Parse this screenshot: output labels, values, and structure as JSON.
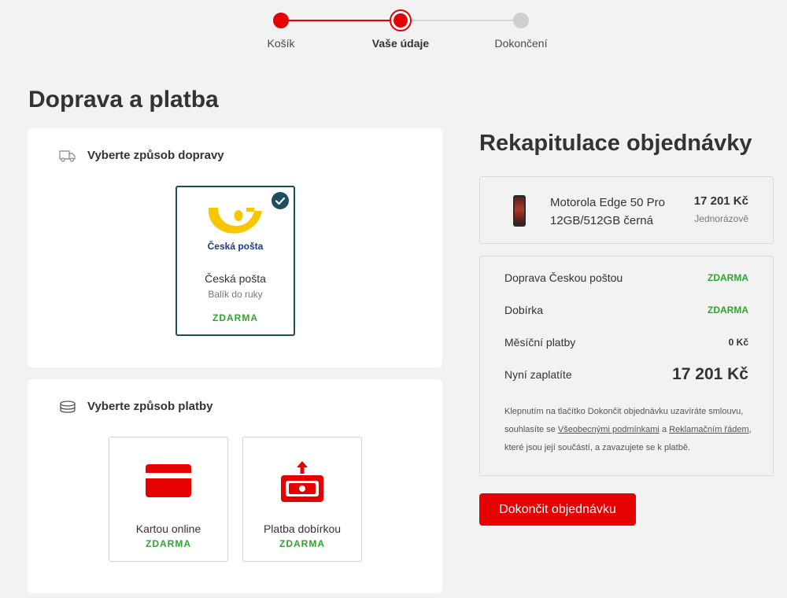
{
  "stepper": {
    "steps": [
      {
        "label": "Košík",
        "state": "done"
      },
      {
        "label": "Vaše údaje",
        "state": "active"
      },
      {
        "label": "Dokončení",
        "state": "todo"
      }
    ]
  },
  "page_title": "Doprava a platba",
  "shipping": {
    "heading": "Vyberte způsob dopravy",
    "icon": "truck-icon",
    "options": [
      {
        "brand": "Česká pošta",
        "name": "Česká pošta",
        "sub": "Balík do ruky",
        "price": "ZDARMA",
        "selected": true
      }
    ]
  },
  "payment": {
    "heading": "Vyberte způsob platby",
    "icon": "coins-icon",
    "options": [
      {
        "name": "Kartou online",
        "price": "ZDARMA",
        "icon": "credit-card-icon"
      },
      {
        "name": "Platba dobírkou",
        "price": "ZDARMA",
        "icon": "cash-on-delivery-icon"
      }
    ]
  },
  "recap": {
    "title": "Rekapitulace objednávky",
    "product": {
      "name": "Motorola Edge 50 Pro 12GB/512GB černá",
      "price": "17 201 Kč",
      "note": "Jednorázově"
    },
    "rows": [
      {
        "label": "Doprava Českou poštou",
        "value": "ZDARMA"
      },
      {
        "label": "Dobírka",
        "value": "ZDARMA"
      },
      {
        "label": "Měsíční platby",
        "value": "0 Kč"
      }
    ],
    "total": {
      "label": "Nyní zaplatíte",
      "value": "17 201 Kč"
    },
    "legal": {
      "part1": "Klepnutím na tlačítko Dokončit objednávku uzavíráte smlouvu, souhlasíte se ",
      "link1": "Všeobecnými podmínkami",
      "part2": " a ",
      "link2": "Reklamačním řádem",
      "part3": ", které jsou její součástí, a zavazujete se k platbě."
    },
    "button": "Dokončit objednávku"
  },
  "colors": {
    "accent": "#e60000",
    "selected_border": "#1e4d5c",
    "free_green": "#2fa52f",
    "posta_yellow": "#f7c600",
    "posta_blue": "#1a3a8a"
  }
}
